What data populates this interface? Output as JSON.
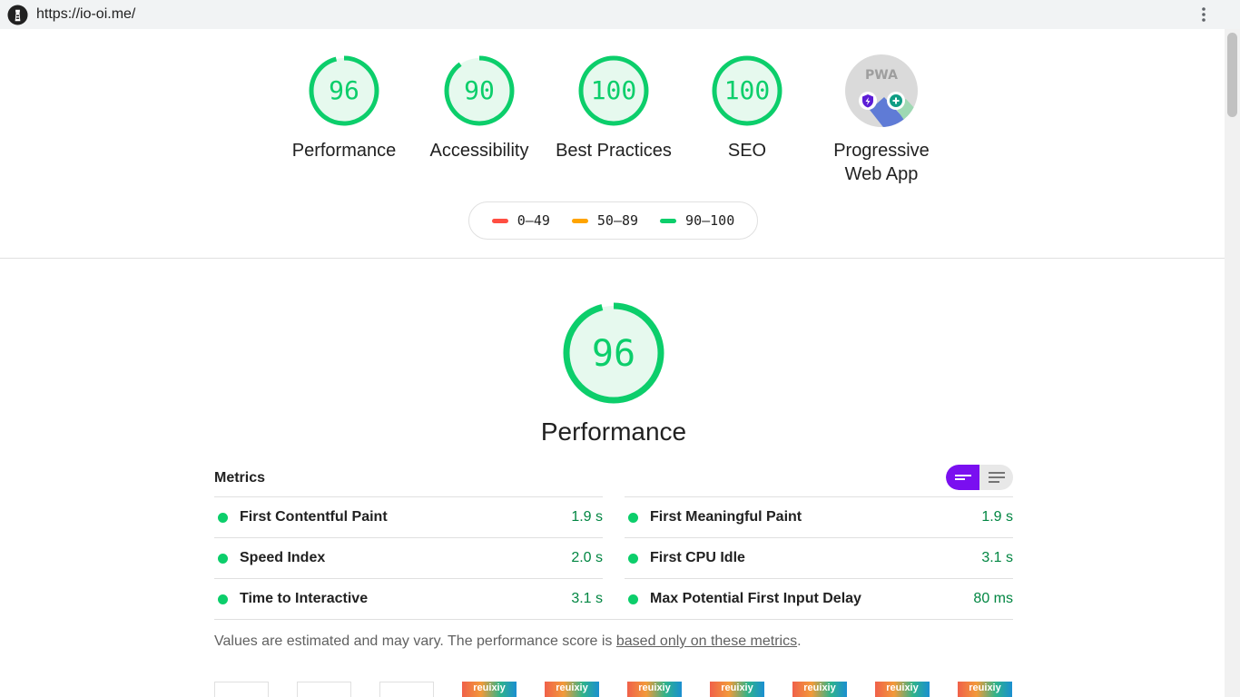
{
  "browser": {
    "url": "https://io-oi.me/"
  },
  "categories": [
    {
      "label": "Performance",
      "score": 96
    },
    {
      "label": "Accessibility",
      "score": 90
    },
    {
      "label": "Best Practices",
      "score": 100
    },
    {
      "label": "SEO",
      "score": 100
    },
    {
      "label": "Progressive Web App",
      "badge_text": "PWA"
    }
  ],
  "legend": [
    {
      "label": "0–49",
      "color": "#ff4e42"
    },
    {
      "label": "50–89",
      "color": "#ffa400"
    },
    {
      "label": "90–100",
      "color": "#0cce6b"
    }
  ],
  "performance": {
    "score": 96,
    "title": "Performance",
    "metrics_heading": "Metrics",
    "metrics": [
      {
        "name": "First Contentful Paint",
        "value": "1.9 s"
      },
      {
        "name": "First Meaningful Paint",
        "value": "1.9 s"
      },
      {
        "name": "Speed Index",
        "value": "2.0 s"
      },
      {
        "name": "First CPU Idle",
        "value": "3.1 s"
      },
      {
        "name": "Time to Interactive",
        "value": "3.1 s"
      },
      {
        "name": "Max Potential First Input Delay",
        "value": "80 ms"
      }
    ],
    "note_text": "Values are estimated and may vary. The performance score is ",
    "note_link": "based only on these metrics",
    "note_end": "."
  },
  "filmstrip": {
    "brand_text": "reuixiy"
  },
  "colors": {
    "pass": "#0cce6b",
    "pass_text": "#018642",
    "toggle_active": "#7a0ff0"
  }
}
